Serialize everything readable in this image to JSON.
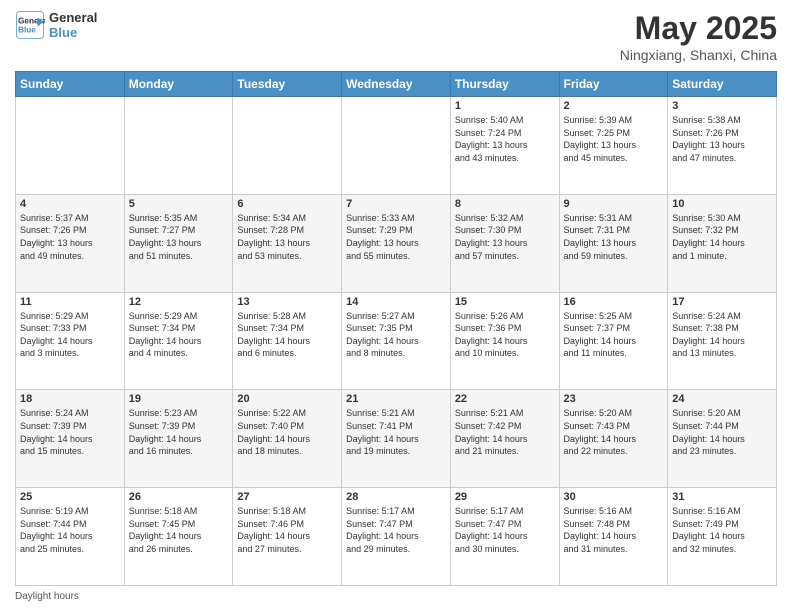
{
  "header": {
    "logo_line1": "General",
    "logo_line2": "Blue",
    "month_title": "May 2025",
    "subtitle": "Ningxiang, Shanxi, China"
  },
  "footer": {
    "daylight_hours_label": "Daylight hours"
  },
  "weekdays": [
    "Sunday",
    "Monday",
    "Tuesday",
    "Wednesday",
    "Thursday",
    "Friday",
    "Saturday"
  ],
  "weeks": [
    [
      {
        "day": "",
        "info": ""
      },
      {
        "day": "",
        "info": ""
      },
      {
        "day": "",
        "info": ""
      },
      {
        "day": "",
        "info": ""
      },
      {
        "day": "1",
        "info": "Sunrise: 5:40 AM\nSunset: 7:24 PM\nDaylight: 13 hours\nand 43 minutes."
      },
      {
        "day": "2",
        "info": "Sunrise: 5:39 AM\nSunset: 7:25 PM\nDaylight: 13 hours\nand 45 minutes."
      },
      {
        "day": "3",
        "info": "Sunrise: 5:38 AM\nSunset: 7:26 PM\nDaylight: 13 hours\nand 47 minutes."
      }
    ],
    [
      {
        "day": "4",
        "info": "Sunrise: 5:37 AM\nSunset: 7:26 PM\nDaylight: 13 hours\nand 49 minutes."
      },
      {
        "day": "5",
        "info": "Sunrise: 5:35 AM\nSunset: 7:27 PM\nDaylight: 13 hours\nand 51 minutes."
      },
      {
        "day": "6",
        "info": "Sunrise: 5:34 AM\nSunset: 7:28 PM\nDaylight: 13 hours\nand 53 minutes."
      },
      {
        "day": "7",
        "info": "Sunrise: 5:33 AM\nSunset: 7:29 PM\nDaylight: 13 hours\nand 55 minutes."
      },
      {
        "day": "8",
        "info": "Sunrise: 5:32 AM\nSunset: 7:30 PM\nDaylight: 13 hours\nand 57 minutes."
      },
      {
        "day": "9",
        "info": "Sunrise: 5:31 AM\nSunset: 7:31 PM\nDaylight: 13 hours\nand 59 minutes."
      },
      {
        "day": "10",
        "info": "Sunrise: 5:30 AM\nSunset: 7:32 PM\nDaylight: 14 hours\nand 1 minute."
      }
    ],
    [
      {
        "day": "11",
        "info": "Sunrise: 5:29 AM\nSunset: 7:33 PM\nDaylight: 14 hours\nand 3 minutes."
      },
      {
        "day": "12",
        "info": "Sunrise: 5:29 AM\nSunset: 7:34 PM\nDaylight: 14 hours\nand 4 minutes."
      },
      {
        "day": "13",
        "info": "Sunrise: 5:28 AM\nSunset: 7:34 PM\nDaylight: 14 hours\nand 6 minutes."
      },
      {
        "day": "14",
        "info": "Sunrise: 5:27 AM\nSunset: 7:35 PM\nDaylight: 14 hours\nand 8 minutes."
      },
      {
        "day": "15",
        "info": "Sunrise: 5:26 AM\nSunset: 7:36 PM\nDaylight: 14 hours\nand 10 minutes."
      },
      {
        "day": "16",
        "info": "Sunrise: 5:25 AM\nSunset: 7:37 PM\nDaylight: 14 hours\nand 11 minutes."
      },
      {
        "day": "17",
        "info": "Sunrise: 5:24 AM\nSunset: 7:38 PM\nDaylight: 14 hours\nand 13 minutes."
      }
    ],
    [
      {
        "day": "18",
        "info": "Sunrise: 5:24 AM\nSunset: 7:39 PM\nDaylight: 14 hours\nand 15 minutes."
      },
      {
        "day": "19",
        "info": "Sunrise: 5:23 AM\nSunset: 7:39 PM\nDaylight: 14 hours\nand 16 minutes."
      },
      {
        "day": "20",
        "info": "Sunrise: 5:22 AM\nSunset: 7:40 PM\nDaylight: 14 hours\nand 18 minutes."
      },
      {
        "day": "21",
        "info": "Sunrise: 5:21 AM\nSunset: 7:41 PM\nDaylight: 14 hours\nand 19 minutes."
      },
      {
        "day": "22",
        "info": "Sunrise: 5:21 AM\nSunset: 7:42 PM\nDaylight: 14 hours\nand 21 minutes."
      },
      {
        "day": "23",
        "info": "Sunrise: 5:20 AM\nSunset: 7:43 PM\nDaylight: 14 hours\nand 22 minutes."
      },
      {
        "day": "24",
        "info": "Sunrise: 5:20 AM\nSunset: 7:44 PM\nDaylight: 14 hours\nand 23 minutes."
      }
    ],
    [
      {
        "day": "25",
        "info": "Sunrise: 5:19 AM\nSunset: 7:44 PM\nDaylight: 14 hours\nand 25 minutes."
      },
      {
        "day": "26",
        "info": "Sunrise: 5:18 AM\nSunset: 7:45 PM\nDaylight: 14 hours\nand 26 minutes."
      },
      {
        "day": "27",
        "info": "Sunrise: 5:18 AM\nSunset: 7:46 PM\nDaylight: 14 hours\nand 27 minutes."
      },
      {
        "day": "28",
        "info": "Sunrise: 5:17 AM\nSunset: 7:47 PM\nDaylight: 14 hours\nand 29 minutes."
      },
      {
        "day": "29",
        "info": "Sunrise: 5:17 AM\nSunset: 7:47 PM\nDaylight: 14 hours\nand 30 minutes."
      },
      {
        "day": "30",
        "info": "Sunrise: 5:16 AM\nSunset: 7:48 PM\nDaylight: 14 hours\nand 31 minutes."
      },
      {
        "day": "31",
        "info": "Sunrise: 5:16 AM\nSunset: 7:49 PM\nDaylight: 14 hours\nand 32 minutes."
      }
    ]
  ]
}
